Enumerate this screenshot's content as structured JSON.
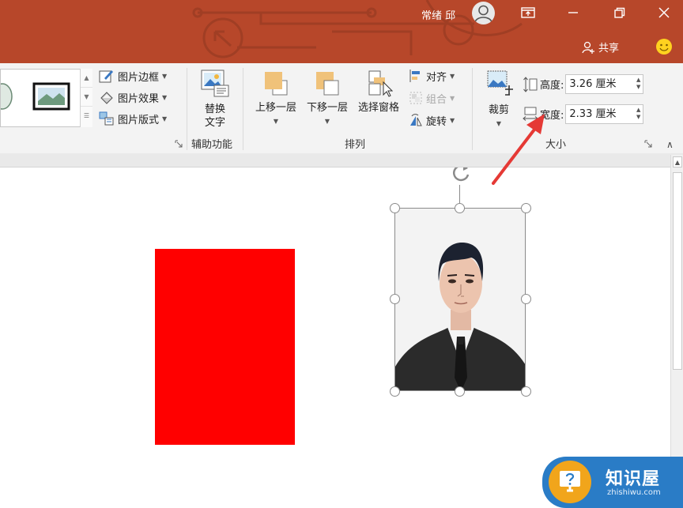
{
  "window": {
    "user_name": "常绪 邱",
    "share_label": "共享",
    "icons": [
      "ribbon-display-icon",
      "minimize-icon",
      "restore-icon",
      "close-icon",
      "share-person-icon",
      "smiley-icon"
    ]
  },
  "ribbon": {
    "picture_styles": {
      "border_label": "图片边框",
      "effects_label": "图片效果",
      "layout_label": "图片版式"
    },
    "accessibility": {
      "alt_text_label_line1": "替换",
      "alt_text_label_line2": "文字",
      "group_label": "辅助功能"
    },
    "arrange": {
      "bring_forward_label": "上移一层",
      "send_backward_label": "下移一层",
      "selection_pane_label": "选择窗格",
      "align_label": "对齐",
      "group_label_cmd": "组合",
      "rotate_label": "旋转",
      "group_label": "排列"
    },
    "size": {
      "crop_label": "裁剪",
      "height_label": "高度:",
      "height_value": "3.26 厘米",
      "width_label": "宽度:",
      "width_value": "2.33 厘米",
      "group_label": "大小"
    }
  },
  "slide": {
    "shapes": [
      "red-rectangle",
      "id-photo"
    ],
    "accent_colors": {
      "title_bar": "#b7472a",
      "shape_fill": "#ff0000",
      "annotation_arrow": "#e53935"
    }
  },
  "watermark": {
    "title": "知识屋",
    "subtitle": "zhishiwu.com"
  }
}
